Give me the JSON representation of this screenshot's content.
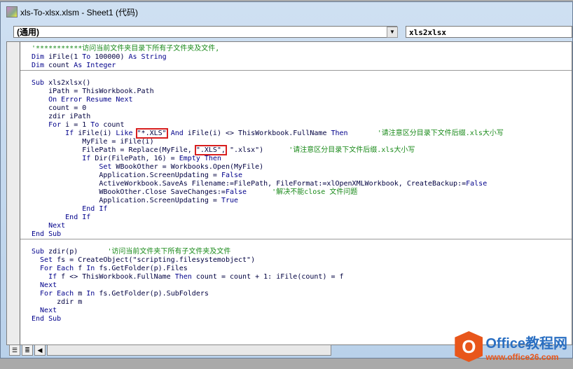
{
  "window": {
    "title": "xls-To-xlsx.xlsm - Sheet1 (代码)"
  },
  "combos": {
    "object": "(通用)",
    "procedure": "xls2xlsx"
  },
  "watermark": {
    "brand": "Office教程网",
    "url": "www.office26.com"
  },
  "sections": [
    [
      [
        [
          "c",
          "'***********访问当前文件夹目录下所有子文件夹及文件,"
        ]
      ],
      [
        [
          "k",
          "Dim "
        ],
        [
          "n",
          "iFile(1 "
        ],
        [
          "k",
          "To"
        ],
        [
          "n",
          " 100000) "
        ],
        [
          "k",
          "As String"
        ]
      ],
      [
        [
          "k",
          "Dim "
        ],
        [
          "n",
          "count "
        ],
        [
          "k",
          "As Integer"
        ]
      ]
    ],
    [
      [
        [
          "n",
          " "
        ]
      ],
      [
        [
          "k",
          "Sub "
        ],
        [
          "n",
          "xls2xlsx()"
        ]
      ],
      [
        [
          "n",
          "    iPath = ThisWorkbook.Path"
        ]
      ],
      [
        [
          "k",
          "    On Error Resume Next"
        ]
      ],
      [
        [
          "n",
          "    count = 0"
        ]
      ],
      [
        [
          "n",
          "    zdir iPath"
        ]
      ],
      [
        [
          "k",
          "    For "
        ],
        [
          "n",
          "i = 1 "
        ],
        [
          "k",
          "To "
        ],
        [
          "n",
          "count"
        ]
      ],
      [
        [
          "k",
          "        If "
        ],
        [
          "n",
          "iFile(i) "
        ],
        [
          "k",
          "Like "
        ],
        [
          "b",
          "\"*.XLS\""
        ],
        [
          "k",
          " And "
        ],
        [
          "n",
          "iFile(i) <> ThisWorkbook.FullName "
        ],
        [
          "k",
          "Then"
        ],
        [
          "c",
          "       '请注意区分目录下文件后缀.xls大小写"
        ]
      ],
      [
        [
          "n",
          "            MyFile = iFile(i)"
        ]
      ],
      [
        [
          "n",
          "            FilePath = Replace(MyFile, "
        ],
        [
          "b",
          "\".XLS\","
        ],
        [
          "n",
          " \".xlsx\")      "
        ],
        [
          "c",
          "'请注意区分目录下文件后缀.xls大小写"
        ]
      ],
      [
        [
          "k",
          "            If "
        ],
        [
          "n",
          "Dir(FilePath, 16) = "
        ],
        [
          "k",
          "Empty Then"
        ]
      ],
      [
        [
          "k",
          "                Set "
        ],
        [
          "n",
          "WBookOther = Workbooks.Open(MyFile)"
        ]
      ],
      [
        [
          "n",
          "                Application.ScreenUpdating = "
        ],
        [
          "k",
          "False"
        ]
      ],
      [
        [
          "n",
          "                ActiveWorkbook.SaveAs Filename:=FilePath, FileFormat:=xlOpenXMLWorkbook, CreateBackup:="
        ],
        [
          "k",
          "False"
        ]
      ],
      [
        [
          "n",
          "                WBookOther.Close SaveChanges:="
        ],
        [
          "k",
          "False"
        ],
        [
          "c",
          "      '解决不能close 文件问题"
        ]
      ],
      [
        [
          "n",
          "                Application.ScreenUpdating = "
        ],
        [
          "k",
          "True"
        ]
      ],
      [
        [
          "k",
          "            End If"
        ]
      ],
      [
        [
          "k",
          "        End If"
        ]
      ],
      [
        [
          "k",
          "    Next"
        ]
      ],
      [
        [
          "k",
          "End Sub"
        ]
      ]
    ],
    [
      [
        [
          "n",
          " "
        ]
      ],
      [
        [
          "k",
          "Sub "
        ],
        [
          "n",
          "zdir(p)       "
        ],
        [
          "c",
          "'访问当前文件夹下所有子文件夹及文件"
        ]
      ],
      [
        [
          "k",
          "  Set "
        ],
        [
          "n",
          "fs = CreateObject(\"scripting.filesystemobject\")"
        ]
      ],
      [
        [
          "k",
          "  For Each "
        ],
        [
          "n",
          "f "
        ],
        [
          "k",
          "In "
        ],
        [
          "n",
          "fs.GetFolder(p).Files"
        ]
      ],
      [
        [
          "k",
          "    If "
        ],
        [
          "n",
          "f <> ThisWorkbook.FullName "
        ],
        [
          "k",
          "Then "
        ],
        [
          "n",
          "count = count + 1: iFile(count) = f"
        ]
      ],
      [
        [
          "k",
          "  Next"
        ]
      ],
      [
        [
          "k",
          "  For Each "
        ],
        [
          "n",
          "m "
        ],
        [
          "k",
          "In "
        ],
        [
          "n",
          "fs.GetFolder(p).SubFolders"
        ]
      ],
      [
        [
          "n",
          "      zdir m"
        ]
      ],
      [
        [
          "k",
          "  Next"
        ]
      ],
      [
        [
          "k",
          "End Sub"
        ]
      ]
    ]
  ]
}
